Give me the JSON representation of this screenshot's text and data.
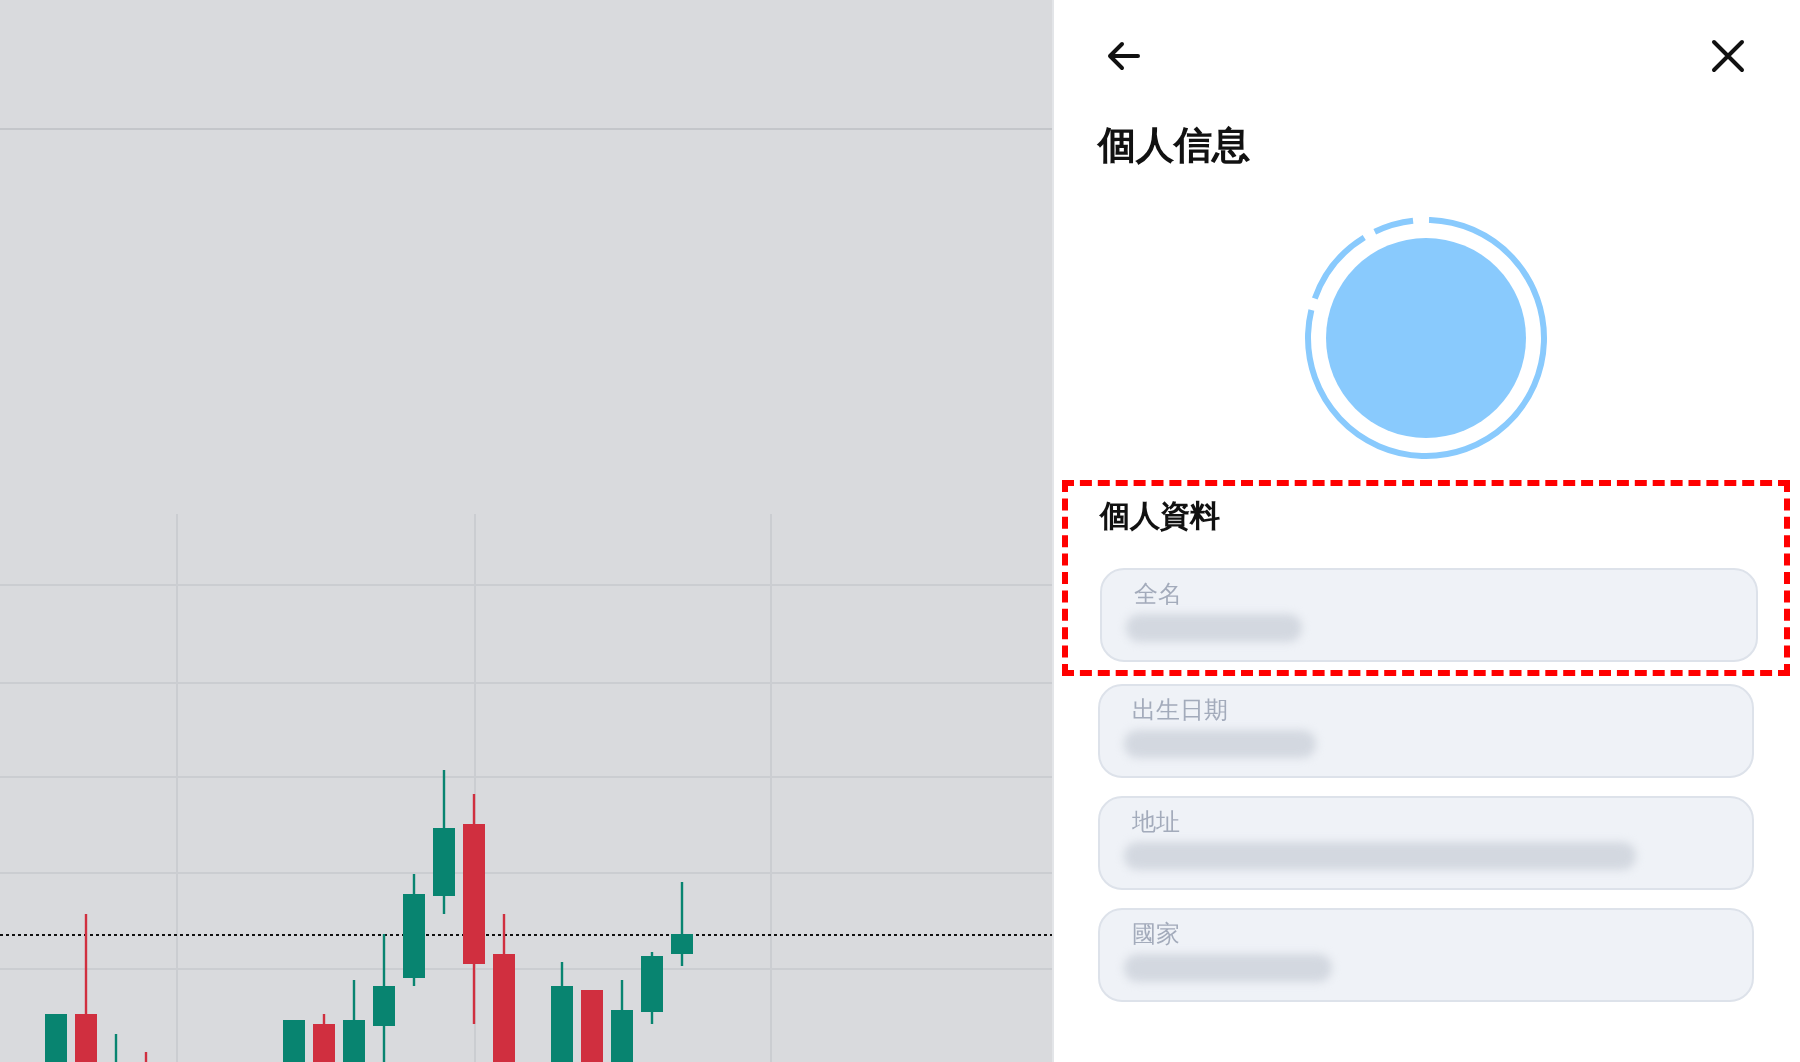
{
  "panel": {
    "title": "個人信息"
  },
  "section": {
    "title": "個人資料",
    "highlighted": true,
    "fields": [
      {
        "label": "全名",
        "redacted": true
      },
      {
        "label": "出生日期",
        "redacted": true
      },
      {
        "label": "地址",
        "redacted": true
      },
      {
        "label": "國家",
        "redacted": true
      }
    ]
  }
}
